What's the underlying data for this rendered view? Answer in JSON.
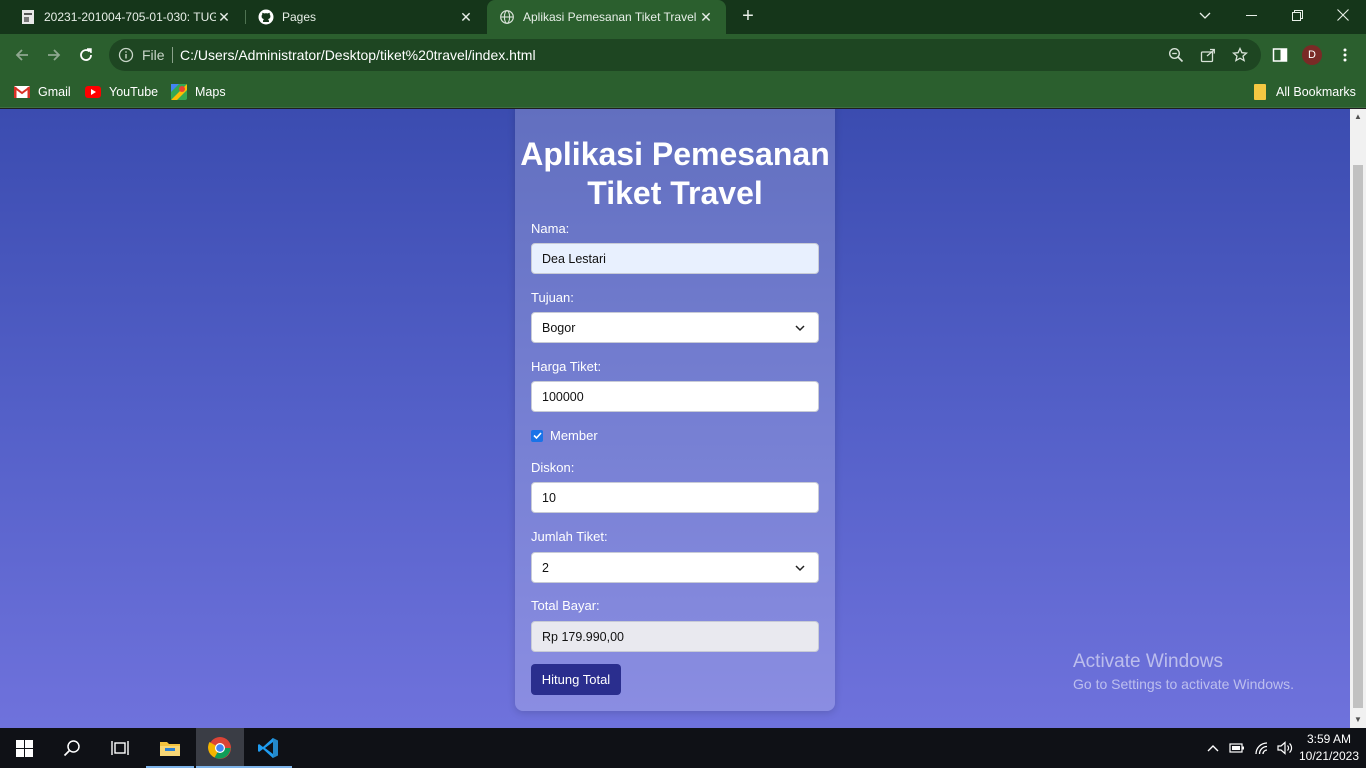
{
  "browser": {
    "tabs": [
      {
        "title": "20231-201004-705-01-030: TUG",
        "icon": "document-icon",
        "active": false
      },
      {
        "title": "Pages",
        "icon": "github-icon",
        "active": false
      },
      {
        "title": "Aplikasi Pemesanan Tiket Travel",
        "icon": "globe-icon",
        "active": true
      }
    ],
    "address": {
      "scheme_label": "File",
      "url": "C:/Users/Administrator/Desktop/tiket%20travel/index.html"
    },
    "profile_initial": "D",
    "bookmarks": [
      {
        "label": "Gmail",
        "icon": "gmail-icon"
      },
      {
        "label": "YouTube",
        "icon": "youtube-icon"
      },
      {
        "label": "Maps",
        "icon": "maps-icon"
      }
    ],
    "all_bookmarks": "All Bookmarks",
    "colors": {
      "theme": "#2b5f2e",
      "tabstrip": "#15361a"
    }
  },
  "form": {
    "title": "Aplikasi Pemesanan Tiket Travel",
    "nama": {
      "label": "Nama:",
      "value": "Dea Lestari"
    },
    "tujuan": {
      "label": "Tujuan:",
      "value": "Bogor"
    },
    "harga": {
      "label": "Harga Tiket:",
      "value": "100000"
    },
    "member": {
      "label": "Member",
      "checked": true
    },
    "diskon": {
      "label": "Diskon:",
      "value": "10"
    },
    "jumlah": {
      "label": "Jumlah Tiket:",
      "value": "2"
    },
    "total": {
      "label": "Total Bayar:",
      "value": "Rp 179.990,00"
    },
    "button": "Hitung Total",
    "colors": {
      "button": "#2a2e8e",
      "bg_top": "#3b4cb0",
      "bg_bottom": "#6f72dc"
    }
  },
  "watermark": {
    "line1": "Activate Windows",
    "line2": "Go to Settings to activate Windows."
  },
  "taskbar": {
    "apps": [
      "windows-start-icon",
      "search-icon",
      "task-view-icon",
      "file-explorer-icon",
      "chrome-icon",
      "vscode-icon"
    ],
    "time": "3:59 AM",
    "date": "10/21/2023"
  }
}
